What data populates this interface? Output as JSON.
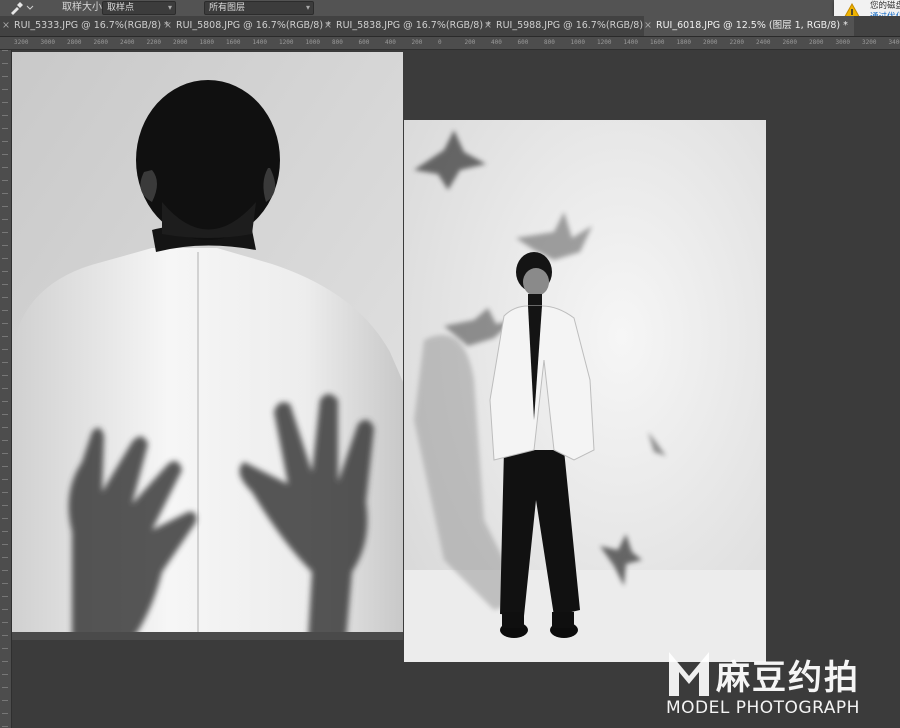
{
  "options_bar": {
    "tool_icon": "eyedropper-icon",
    "sample_size_label": "取样大小:",
    "sample_size_value": "取样点",
    "sample_layers_value": "所有图层"
  },
  "tabs": [
    {
      "label": "RUI_5333.JPG @ 16.7%(RGB/8) *"
    },
    {
      "label": "RUI_5808.JPG @ 16.7%(RGB/8) *"
    },
    {
      "label": "RUI_5838.JPG @ 16.7%(RGB/8) *"
    },
    {
      "label": "RUI_5988.JPG @ 16.7%(RGB/8) *"
    },
    {
      "label": "RUI_6018.JPG @ 12.5% (图层 1, RGB/8) *"
    }
  ],
  "tab_close_glyph": "×",
  "ruler_ticks": [
    "3200",
    "3000",
    "2800",
    "2600",
    "2400",
    "2200",
    "2000",
    "1800",
    "1600",
    "1400",
    "1200",
    "1000",
    "800",
    "600",
    "400",
    "200",
    "0",
    "200",
    "400",
    "600",
    "800",
    "1000",
    "1200",
    "1400",
    "1600",
    "1800",
    "2000",
    "2200",
    "2400",
    "2600",
    "2800",
    "3000",
    "3200",
    "3400",
    "3600",
    "3800",
    "4000",
    "4200"
  ],
  "notification": {
    "icon": "warning-icon",
    "line1": "您的磁盘",
    "line2": "通过优化"
  },
  "watermark": {
    "logo": "M",
    "chinese": "麻豆约拍",
    "english": "MODEL PHOTOGRAPH"
  }
}
